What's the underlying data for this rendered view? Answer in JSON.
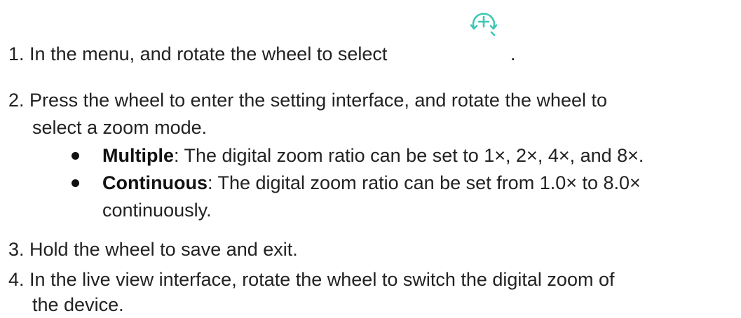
{
  "steps": [
    {
      "num": "1.",
      "line1": "In the menu, and rotate the wheel to select",
      "after_icon": ".",
      "icon": "zoom-in-rotate-icon"
    },
    {
      "num": "2.",
      "line1": "Press the wheel to enter the setting interface, and rotate the wheel to",
      "line2": "select a zoom mode.",
      "bullets": [
        {
          "term": "Multiple",
          "text1": ": The digital zoom ratio can be set to 1×, 2×, 4×, and 8×."
        },
        {
          "term": "Continuous",
          "text1": ": The digital zoom ratio can be set from 1.0× to 8.0×",
          "text2": "continuously."
        }
      ]
    },
    {
      "num": "3.",
      "line1": "Hold the wheel to save and exit."
    },
    {
      "num": "4.",
      "line1": "In the live view interface, rotate the wheel to switch the digital zoom of",
      "line2": "the device."
    }
  ],
  "colors": {
    "text": "#222222",
    "icon_accent": "#3ec7b4"
  }
}
